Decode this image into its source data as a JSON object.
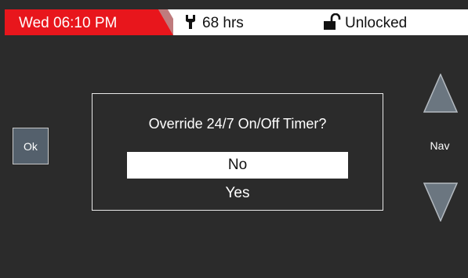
{
  "status_bar": {
    "datetime": "Wed 06:10 PM",
    "hours": "68 hrs",
    "lock_status": "Unlocked",
    "hours_icon": "wrench-icon",
    "lock_icon": "unlocked-padlock-icon",
    "accent_color": "#e8161c"
  },
  "buttons": {
    "ok_label": "Ok"
  },
  "dialog": {
    "title": "Override 24/7 On/Off Timer?",
    "options": [
      {
        "label": "No",
        "selected": true
      },
      {
        "label": "Yes",
        "selected": false
      }
    ]
  },
  "nav": {
    "label": "Nav",
    "up_icon": "triangle-up-icon",
    "down_icon": "triangle-down-icon"
  }
}
